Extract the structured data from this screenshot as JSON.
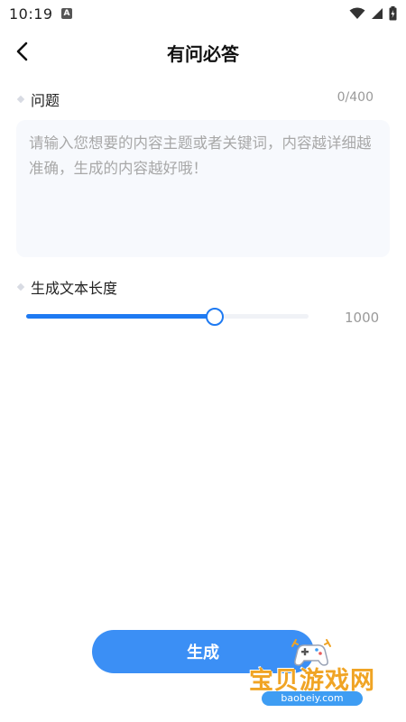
{
  "status_bar": {
    "time": "10:19",
    "notification_badge": "A"
  },
  "header": {
    "title": "有问必答",
    "back_icon": "chevron-left-icon"
  },
  "question": {
    "label": "问题",
    "counter": "0/400",
    "value": "",
    "placeholder": "请输入您想要的内容主题或者关键词，内容越详细越准确，生成的内容越好哦！"
  },
  "length": {
    "label": "生成文本长度",
    "value_text": "1000",
    "slider_fraction": 0.667
  },
  "actions": {
    "generate_label": "生成"
  },
  "watermark": {
    "name": "宝贝游戏网",
    "url": "baobeiy.com"
  },
  "colors": {
    "accent": "#1e7af2",
    "button": "#3b8ff5",
    "input_bg": "#f7f9fd",
    "muted_text": "#9a9a9a",
    "watermark_orange": "#f0a424"
  }
}
